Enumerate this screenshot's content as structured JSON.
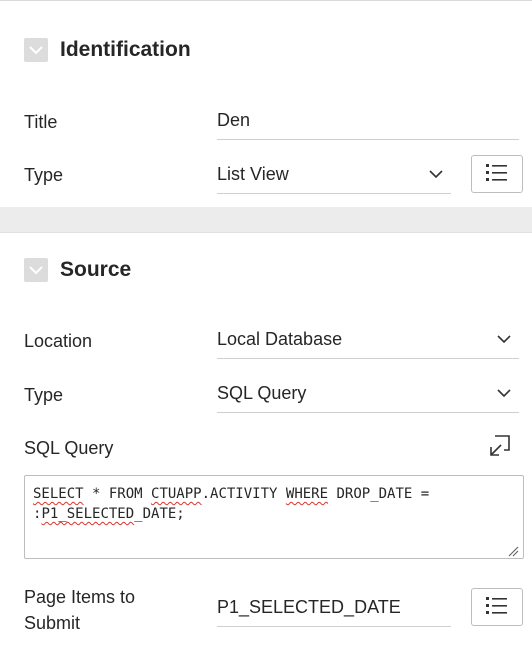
{
  "identification": {
    "title": "Identification",
    "title_label": "Title",
    "title_value": "Den",
    "type_label": "Type",
    "type_value": "List View"
  },
  "source": {
    "title": "Source",
    "location_label": "Location",
    "location_value": "Local Database",
    "type_label": "Type",
    "type_value": "SQL Query",
    "sql_label": "SQL Query",
    "sql_parts": [
      [
        "SELECT",
        " * FROM ",
        "CTUAPP",
        ".ACTIVITY ",
        "WHERE",
        " DROP_DATE ="
      ],
      [
        ":",
        "P1_SELECTED",
        "_DATE;"
      ]
    ],
    "page_items_label_1": "Page Items to",
    "page_items_label_2": "Submit",
    "page_items_value": "P1_SELECTED_DATE"
  },
  "icons": {
    "section_toggle": "chevron-down-icon",
    "select_caret": "chevron-down-icon",
    "list_picker": "list-icon",
    "expand_editor": "expand-icon",
    "resize": "resize-handle-icon"
  },
  "colors": {
    "toggle_bg": "#dcdcdc",
    "spell_error": "#d9342b",
    "separator": "#ececec"
  }
}
